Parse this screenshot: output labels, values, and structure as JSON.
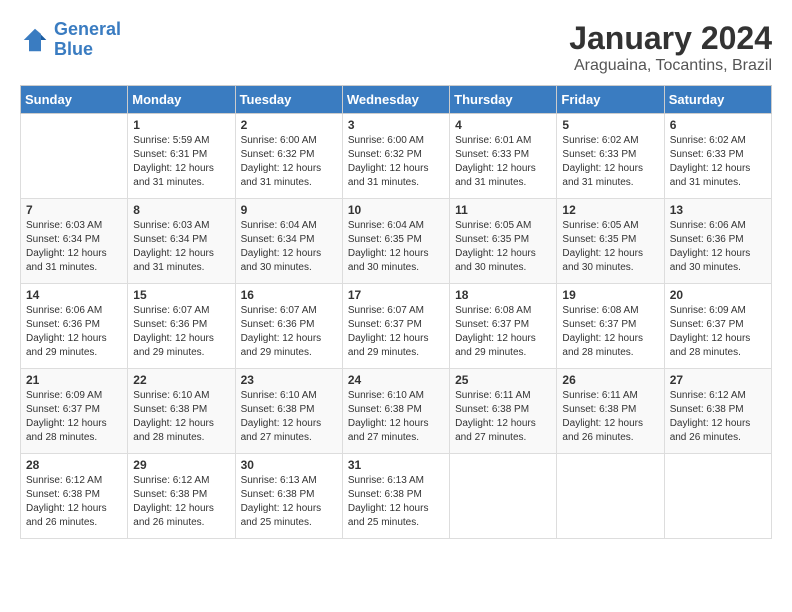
{
  "header": {
    "logo_line1": "General",
    "logo_line2": "Blue",
    "month": "January 2024",
    "location": "Araguaina, Tocantins, Brazil"
  },
  "weekdays": [
    "Sunday",
    "Monday",
    "Tuesday",
    "Wednesday",
    "Thursday",
    "Friday",
    "Saturday"
  ],
  "weeks": [
    [
      {
        "day": "",
        "sunrise": "",
        "sunset": "",
        "daylight": ""
      },
      {
        "day": "1",
        "sunrise": "Sunrise: 5:59 AM",
        "sunset": "Sunset: 6:31 PM",
        "daylight": "Daylight: 12 hours and 31 minutes."
      },
      {
        "day": "2",
        "sunrise": "Sunrise: 6:00 AM",
        "sunset": "Sunset: 6:32 PM",
        "daylight": "Daylight: 12 hours and 31 minutes."
      },
      {
        "day": "3",
        "sunrise": "Sunrise: 6:00 AM",
        "sunset": "Sunset: 6:32 PM",
        "daylight": "Daylight: 12 hours and 31 minutes."
      },
      {
        "day": "4",
        "sunrise": "Sunrise: 6:01 AM",
        "sunset": "Sunset: 6:33 PM",
        "daylight": "Daylight: 12 hours and 31 minutes."
      },
      {
        "day": "5",
        "sunrise": "Sunrise: 6:02 AM",
        "sunset": "Sunset: 6:33 PM",
        "daylight": "Daylight: 12 hours and 31 minutes."
      },
      {
        "day": "6",
        "sunrise": "Sunrise: 6:02 AM",
        "sunset": "Sunset: 6:33 PM",
        "daylight": "Daylight: 12 hours and 31 minutes."
      }
    ],
    [
      {
        "day": "7",
        "sunrise": "Sunrise: 6:03 AM",
        "sunset": "Sunset: 6:34 PM",
        "daylight": "Daylight: 12 hours and 31 minutes."
      },
      {
        "day": "8",
        "sunrise": "Sunrise: 6:03 AM",
        "sunset": "Sunset: 6:34 PM",
        "daylight": "Daylight: 12 hours and 31 minutes."
      },
      {
        "day": "9",
        "sunrise": "Sunrise: 6:04 AM",
        "sunset": "Sunset: 6:34 PM",
        "daylight": "Daylight: 12 hours and 30 minutes."
      },
      {
        "day": "10",
        "sunrise": "Sunrise: 6:04 AM",
        "sunset": "Sunset: 6:35 PM",
        "daylight": "Daylight: 12 hours and 30 minutes."
      },
      {
        "day": "11",
        "sunrise": "Sunrise: 6:05 AM",
        "sunset": "Sunset: 6:35 PM",
        "daylight": "Daylight: 12 hours and 30 minutes."
      },
      {
        "day": "12",
        "sunrise": "Sunrise: 6:05 AM",
        "sunset": "Sunset: 6:35 PM",
        "daylight": "Daylight: 12 hours and 30 minutes."
      },
      {
        "day": "13",
        "sunrise": "Sunrise: 6:06 AM",
        "sunset": "Sunset: 6:36 PM",
        "daylight": "Daylight: 12 hours and 30 minutes."
      }
    ],
    [
      {
        "day": "14",
        "sunrise": "Sunrise: 6:06 AM",
        "sunset": "Sunset: 6:36 PM",
        "daylight": "Daylight: 12 hours and 29 minutes."
      },
      {
        "day": "15",
        "sunrise": "Sunrise: 6:07 AM",
        "sunset": "Sunset: 6:36 PM",
        "daylight": "Daylight: 12 hours and 29 minutes."
      },
      {
        "day": "16",
        "sunrise": "Sunrise: 6:07 AM",
        "sunset": "Sunset: 6:36 PM",
        "daylight": "Daylight: 12 hours and 29 minutes."
      },
      {
        "day": "17",
        "sunrise": "Sunrise: 6:07 AM",
        "sunset": "Sunset: 6:37 PM",
        "daylight": "Daylight: 12 hours and 29 minutes."
      },
      {
        "day": "18",
        "sunrise": "Sunrise: 6:08 AM",
        "sunset": "Sunset: 6:37 PM",
        "daylight": "Daylight: 12 hours and 29 minutes."
      },
      {
        "day": "19",
        "sunrise": "Sunrise: 6:08 AM",
        "sunset": "Sunset: 6:37 PM",
        "daylight": "Daylight: 12 hours and 28 minutes."
      },
      {
        "day": "20",
        "sunrise": "Sunrise: 6:09 AM",
        "sunset": "Sunset: 6:37 PM",
        "daylight": "Daylight: 12 hours and 28 minutes."
      }
    ],
    [
      {
        "day": "21",
        "sunrise": "Sunrise: 6:09 AM",
        "sunset": "Sunset: 6:37 PM",
        "daylight": "Daylight: 12 hours and 28 minutes."
      },
      {
        "day": "22",
        "sunrise": "Sunrise: 6:10 AM",
        "sunset": "Sunset: 6:38 PM",
        "daylight": "Daylight: 12 hours and 28 minutes."
      },
      {
        "day": "23",
        "sunrise": "Sunrise: 6:10 AM",
        "sunset": "Sunset: 6:38 PM",
        "daylight": "Daylight: 12 hours and 27 minutes."
      },
      {
        "day": "24",
        "sunrise": "Sunrise: 6:10 AM",
        "sunset": "Sunset: 6:38 PM",
        "daylight": "Daylight: 12 hours and 27 minutes."
      },
      {
        "day": "25",
        "sunrise": "Sunrise: 6:11 AM",
        "sunset": "Sunset: 6:38 PM",
        "daylight": "Daylight: 12 hours and 27 minutes."
      },
      {
        "day": "26",
        "sunrise": "Sunrise: 6:11 AM",
        "sunset": "Sunset: 6:38 PM",
        "daylight": "Daylight: 12 hours and 26 minutes."
      },
      {
        "day": "27",
        "sunrise": "Sunrise: 6:12 AM",
        "sunset": "Sunset: 6:38 PM",
        "daylight": "Daylight: 12 hours and 26 minutes."
      }
    ],
    [
      {
        "day": "28",
        "sunrise": "Sunrise: 6:12 AM",
        "sunset": "Sunset: 6:38 PM",
        "daylight": "Daylight: 12 hours and 26 minutes."
      },
      {
        "day": "29",
        "sunrise": "Sunrise: 6:12 AM",
        "sunset": "Sunset: 6:38 PM",
        "daylight": "Daylight: 12 hours and 26 minutes."
      },
      {
        "day": "30",
        "sunrise": "Sunrise: 6:13 AM",
        "sunset": "Sunset: 6:38 PM",
        "daylight": "Daylight: 12 hours and 25 minutes."
      },
      {
        "day": "31",
        "sunrise": "Sunrise: 6:13 AM",
        "sunset": "Sunset: 6:38 PM",
        "daylight": "Daylight: 12 hours and 25 minutes."
      },
      {
        "day": "",
        "sunrise": "",
        "sunset": "",
        "daylight": ""
      },
      {
        "day": "",
        "sunrise": "",
        "sunset": "",
        "daylight": ""
      },
      {
        "day": "",
        "sunrise": "",
        "sunset": "",
        "daylight": ""
      }
    ]
  ]
}
